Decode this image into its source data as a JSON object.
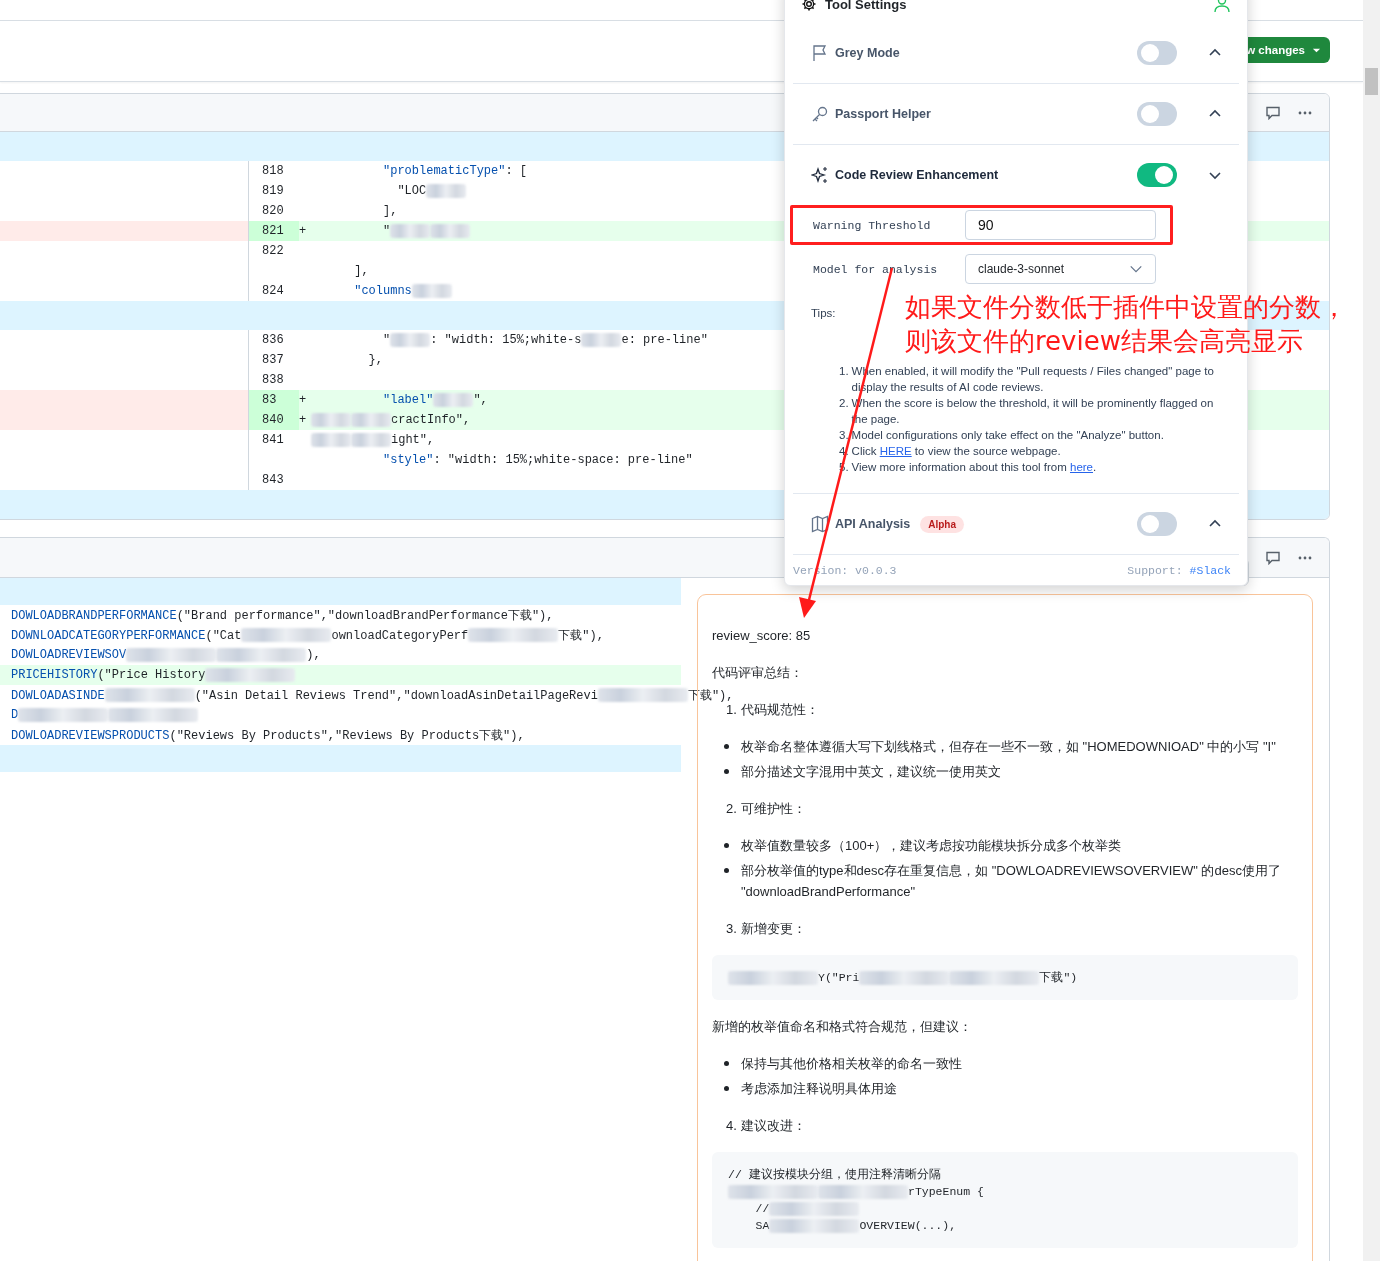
{
  "header": {
    "button": {
      "label": "w changes"
    }
  },
  "files": [
    {
      "rows": [
        {
          "kind": "hunk"
        },
        {
          "kind": "context",
          "number": "818",
          "code": [
            {
              "kind": "key",
              "text": "          \"problematicType\""
            },
            {
              "kind": "text",
              "text": ": ["
            }
          ]
        },
        {
          "kind": "context",
          "number": "819",
          "code": [
            {
              "kind": "text",
              "text": "            \"LOC"
            },
            {
              "kind": "blur"
            }
          ]
        },
        {
          "kind": "context",
          "number": "820",
          "code": [
            {
              "kind": "text",
              "text": "          ],"
            }
          ]
        },
        {
          "kind": "added",
          "number": "821",
          "marker": "+",
          "code": [
            {
              "kind": "text",
              "text": "          \""
            },
            {
              "kind": "blur"
            },
            {
              "kind": "blur"
            }
          ]
        },
        {
          "kind": "context",
          "number": "822",
          "code": []
        },
        {
          "kind": "context",
          "code": [
            {
              "kind": "text",
              "text": "      ],"
            }
          ]
        },
        {
          "kind": "context",
          "number": "824",
          "code": [
            {
              "kind": "key",
              "text": "      \"columns"
            },
            {
              "kind": "blur"
            }
          ]
        },
        {
          "kind": "hunk"
        },
        {
          "kind": "context",
          "number": "836",
          "code": [
            {
              "kind": "text",
              "text": "          \""
            },
            {
              "kind": "blur"
            },
            {
              "kind": "text",
              "text": ": \"width: 15%;white-s"
            },
            {
              "kind": "blur"
            },
            {
              "kind": "text",
              "text": "e: pre-line\""
            }
          ]
        },
        {
          "kind": "context",
          "number": "837",
          "code": [
            {
              "kind": "text",
              "text": "        },"
            }
          ]
        },
        {
          "kind": "context",
          "number": "838",
          "code": []
        },
        {
          "kind": "added",
          "number": "83",
          "marker": "+",
          "code": [
            {
              "kind": "key",
              "text": "          \"label\""
            },
            {
              "kind": "blur"
            },
            {
              "kind": "text",
              "text": "\","
            }
          ]
        },
        {
          "kind": "added",
          "number": "840",
          "marker": "+",
          "code": [
            {
              "kind": "blur"
            },
            {
              "kind": "blur"
            },
            {
              "kind": "text",
              "text": "cractInfo\","
            }
          ]
        },
        {
          "kind": "context",
          "number": "841",
          "code": [
            {
              "kind": "blur"
            },
            {
              "kind": "blur"
            },
            {
              "kind": "text",
              "text": "ight\","
            }
          ]
        },
        {
          "kind": "context",
          "code": [
            {
              "kind": "key",
              "text": "          \"style\""
            },
            {
              "kind": "text",
              "text": ": \"width: 15%;white-space: pre-line\""
            }
          ]
        },
        {
          "kind": "context",
          "number": "843",
          "code": []
        },
        {
          "kind": "hunk"
        }
      ]
    },
    {
      "code_rows": [
        {
          "kind": "hunk"
        },
        {
          "kind": "context",
          "code": [
            {
              "kind": "key",
              "text": "DOWLOADBRANDPERFORMANCE"
            },
            {
              "kind": "text",
              "text": "(\"Brand performance\",\"downloadBrandPerformance下载\"),"
            }
          ]
        },
        {
          "kind": "context",
          "code": [
            {
              "kind": "key",
              "text": "DOWNLOADCATEGORYPERFORMANCE"
            },
            {
              "kind": "text",
              "text": "(\"Cat"
            },
            {
              "kind": "blur"
            },
            {
              "kind": "text",
              "text": "ownloadCategoryPerf"
            },
            {
              "kind": "blur"
            },
            {
              "kind": "text",
              "text": "下载\"),"
            }
          ]
        },
        {
          "kind": "context",
          "code": [
            {
              "kind": "key",
              "text": "DOWLOADREVIEWSOV"
            },
            {
              "kind": "blur"
            },
            {
              "kind": "blur"
            },
            {
              "kind": "text",
              "text": "),"
            }
          ]
        },
        {
          "kind": "added",
          "code": [
            {
              "kind": "key",
              "text": "PRICEHISTORY"
            },
            {
              "kind": "text",
              "text": "(\"Price History"
            },
            {
              "kind": "blur"
            }
          ]
        },
        {
          "kind": "context",
          "code": [
            {
              "kind": "key",
              "text": "DOWLOADASINDE"
            },
            {
              "kind": "blur"
            },
            {
              "kind": "text",
              "text": "(\"Asin Detail Reviews Trend\",\"downloadAsinDetailPageRevi"
            },
            {
              "kind": "blur"
            },
            {
              "kind": "text",
              "text": "下载\"),"
            }
          ]
        },
        {
          "kind": "context",
          "code": [
            {
              "kind": "key",
              "text": "D"
            },
            {
              "kind": "blur"
            },
            {
              "kind": "blur"
            }
          ]
        },
        {
          "kind": "context",
          "code": [
            {
              "kind": "key",
              "text": "DOWLOADREVIEWSPRODUCTS"
            },
            {
              "kind": "text",
              "text": "(\"Reviews By Products\",\"Reviews By Products下载\"),"
            }
          ]
        },
        {
          "kind": "hunk"
        }
      ],
      "review": [
        {
          "kind": "para",
          "text": "review_score: 85"
        },
        {
          "kind": "para",
          "text": "代码评审总结："
        },
        {
          "kind": "heading",
          "number": "1.",
          "text": "代码规范性："
        },
        {
          "kind": "bullets",
          "items": [
            "枚举命名整体遵循大写下划线格式，但存在一些不一致，如 \"HOMEDOWNIOAD\" 中的小写 \"I\"",
            "部分描述文字混用中英文，建议统一使用英文"
          ]
        },
        {
          "kind": "heading",
          "number": "2.",
          "text": "可维护性："
        },
        {
          "kind": "bullets",
          "items": [
            "枚举值数量较多（100+），建议考虑按功能模块拆分成多个枚举类",
            "部分枚举值的type和desc存在重复信息，如 \"DOWLOADREVIEWSOVERVIEW\" 的desc使用了 \"downloadBrandPerformance\""
          ]
        },
        {
          "kind": "heading",
          "number": "3.",
          "text": "新增变更："
        },
        {
          "kind": "code",
          "lines": [
            [
              {
                "kind": "blur"
              },
              {
                "kind": "text",
                "text": "Y(\"Pri"
              },
              {
                "kind": "blur"
              },
              {
                "kind": "blur"
              },
              {
                "kind": "text",
                "text": "下载\")"
              }
            ]
          ]
        },
        {
          "kind": "para",
          "text": "新增的枚举值命名和格式符合规范，但建议："
        },
        {
          "kind": "bullets",
          "items": [
            "保持与其他价格相关枚举的命名一致性",
            "考虑添加注释说明具体用途"
          ]
        },
        {
          "kind": "heading",
          "number": "4.",
          "text": "建议改进："
        },
        {
          "kind": "code",
          "lines": [
            [
              {
                "kind": "text",
                "text": "// 建议按模块分组，使用注释清晰分隔"
              }
            ],
            [
              {
                "kind": "blur"
              },
              {
                "kind": "blur"
              },
              {
                "kind": "text",
                "text": "rTypeEnum {"
              }
            ],
            [
              {
                "kind": "text",
                "text": "    //"
              },
              {
                "kind": "blur"
              }
            ],
            [
              {
                "kind": "text",
                "text": "    SA"
              },
              {
                "kind": "blur"
              },
              {
                "kind": "text",
                "text": "OVERVIEW(...),"
              }
            ]
          ]
        }
      ]
    }
  ],
  "tool_settings": {
    "title": "Tool Settings",
    "sections": [
      {
        "title": "Grey Mode",
        "on": false,
        "expanded": false
      },
      {
        "title": "Passport Helper",
        "on": false,
        "expanded": false
      },
      {
        "title": "Code Review Enhancement",
        "on": true,
        "expanded": true,
        "fields": [
          {
            "kind": "input",
            "label": "Warning Threshold",
            "value": "90",
            "highlighted": true
          },
          {
            "kind": "select",
            "label": "Model for analysis",
            "value": "claude-3-sonnet",
            "highlighted": false
          }
        ],
        "tips": {
          "label": "Tips:",
          "items": [
            {
              "number": "1.",
              "parts": [
                {
                  "text": "When enabled, it will modify the \"Pull requests / Files changed\" page to display the results of AI code reviews."
                }
              ]
            },
            {
              "number": "2.",
              "parts": [
                {
                  "text": "When the score is below the threshold, it will be prominently flagged on the page."
                }
              ]
            },
            {
              "number": "3.",
              "parts": [
                {
                  "text": "Model configurations only take effect on the \"Analyze\" button."
                }
              ]
            },
            {
              "number": "4.",
              "parts": [
                {
                  "text": "Click "
                },
                {
                  "link": "HERE"
                },
                {
                  "text": " to view the source webpage."
                }
              ]
            },
            {
              "number": "5.",
              "parts": [
                {
                  "text": "View more information about this tool from "
                },
                {
                  "link": "here"
                },
                {
                  "text": "."
                }
              ]
            }
          ]
        }
      },
      {
        "title": "API Analysis",
        "badge": "Alpha",
        "on": false,
        "expanded": false
      }
    ],
    "version": "Version: v0.0.3",
    "support_label": "Support:",
    "support_link": "#Slack"
  },
  "annotation": {
    "lines": [
      "如果文件分数低于插件中设置的分数，",
      "则该文件的review结果会高亮显示"
    ]
  }
}
